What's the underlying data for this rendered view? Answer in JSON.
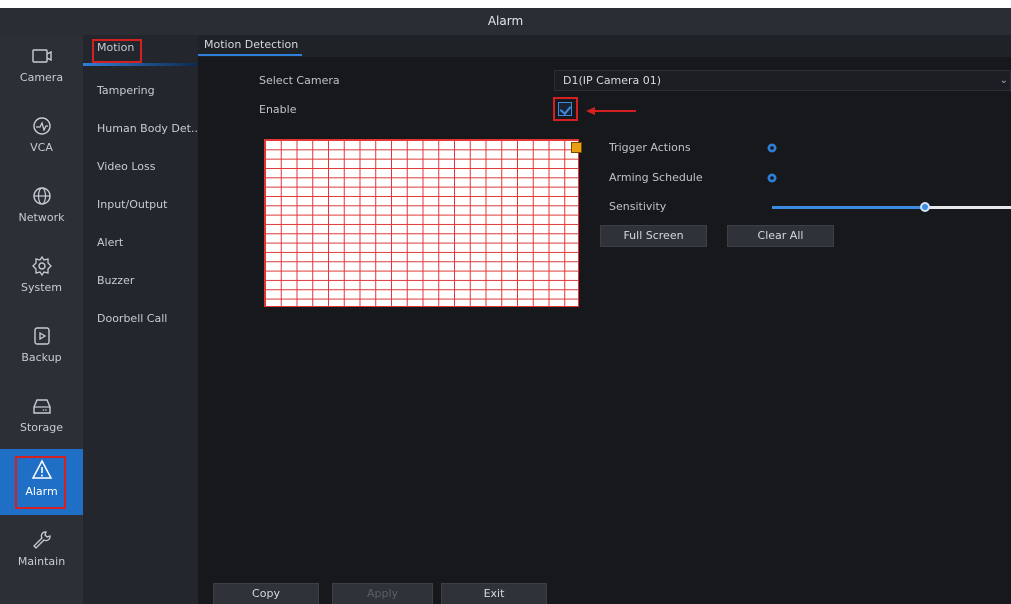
{
  "window": {
    "title": "Alarm"
  },
  "main_nav": [
    {
      "label": "Camera",
      "icon": "camera-icon"
    },
    {
      "label": "VCA",
      "icon": "vca-icon"
    },
    {
      "label": "Network",
      "icon": "globe-icon"
    },
    {
      "label": "System",
      "icon": "gear-icon"
    },
    {
      "label": "Backup",
      "icon": "backup-icon"
    },
    {
      "label": "Storage",
      "icon": "hdd-icon"
    },
    {
      "label": "Alarm",
      "icon": "warning-icon"
    },
    {
      "label": "Maintain",
      "icon": "wrench-icon"
    }
  ],
  "sub_nav": [
    {
      "label": "Motion"
    },
    {
      "label": "Tampering"
    },
    {
      "label": "Human Body Det..."
    },
    {
      "label": "Video Loss"
    },
    {
      "label": "Input/Output"
    },
    {
      "label": "Alert"
    },
    {
      "label": "Buzzer"
    },
    {
      "label": "Doorbell Call"
    }
  ],
  "tab": {
    "label": "Motion Detection"
  },
  "form": {
    "select_camera_label": "Select Camera",
    "select_camera_value": "D1(IP Camera 01)",
    "enable_label": "Enable",
    "enable_checked": true,
    "trigger_actions_label": "Trigger Actions",
    "arming_schedule_label": "Arming Schedule",
    "sensitivity_label": "Sensitivity",
    "sensitivity_level": 0.64,
    "full_screen_label": "Full Screen",
    "clear_all_label": "Clear All"
  },
  "footer": {
    "copy_label": "Copy",
    "apply_label": "Apply",
    "exit_label": "Exit"
  },
  "colors": {
    "accent": "#2e7fd8",
    "highlight": "#d42020",
    "grid_line": "#e23434"
  }
}
